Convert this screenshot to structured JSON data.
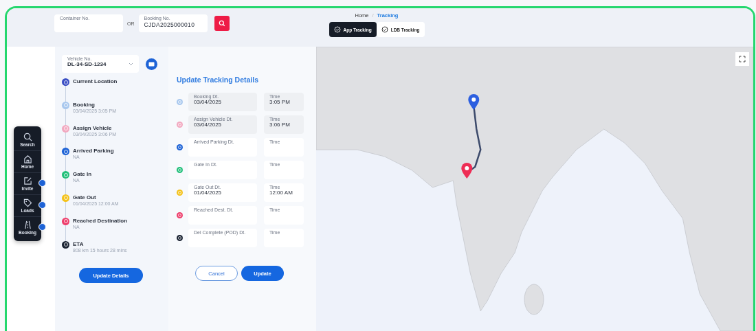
{
  "search": {
    "fields": [
      {
        "label": "Container No."
      },
      {
        "label": "Booking No.",
        "value": "CJDA2025000010"
      }
    ],
    "separator": "OR"
  },
  "breadcrumb": [
    {
      "label": "Home",
      "selected": false
    },
    {
      "label": "Tracking",
      "selected": true
    }
  ],
  "breadcrumb_separator": "/",
  "tabs": [
    {
      "label": "App Tracking",
      "selected": true
    },
    {
      "label": "LDB Tracking",
      "selected": false
    }
  ],
  "nav": [
    {
      "label": "Search",
      "badge": false
    },
    {
      "label": "Home",
      "badge": false
    },
    {
      "label": "Invite",
      "badge": true
    },
    {
      "label": "Loads",
      "badge": true
    },
    {
      "label": "Booking",
      "badge": true
    }
  ],
  "vehicle": {
    "label": "Vehicle No.",
    "value": "DL-34-SD-1234"
  },
  "timeline": [
    {
      "title": "Current Location",
      "color": "#3b4fc4"
    },
    {
      "title": "Booking",
      "detail": "03/04/2025 3:05 PM",
      "color": "#a9c8ee"
    },
    {
      "title": "Assign Vehicle",
      "detail": "03/04/2025 3:06 PM",
      "color": "#f2a9c0"
    },
    {
      "title": "Arrived Parking",
      "detail": "NA",
      "color": "#1e63d6"
    },
    {
      "title": "Gate In",
      "detail": "NA",
      "color": "#22c07a"
    },
    {
      "title": "Gate Out",
      "detail": "01/04/2025 12:00 AM",
      "color": "#f4c21a"
    },
    {
      "title": "Reached Destination",
      "detail": "NA",
      "color": "#ee3f6c"
    },
    {
      "title": "ETA",
      "detail": "808 km 15 hours 28 mins",
      "color": "#1b2433"
    }
  ],
  "update_details": "Update Details",
  "form": {
    "title": "Update Tracking Details",
    "rows": [
      {
        "color": "#a9c8ee",
        "date_label": "Booking Dt.",
        "date_value": "03/04/2025",
        "time_label": "Time",
        "time_value": "3:05 PM",
        "disabled": true
      },
      {
        "color": "#f2a9c0",
        "date_label": "Assign Vehicle Dt.",
        "date_value": "03/04/2025",
        "time_label": "Time",
        "time_value": "3:06 PM",
        "disabled": true
      },
      {
        "color": "#1e63d6",
        "date_label": "Arrived Parking Dt.",
        "time_label": "Time",
        "disabled": false
      },
      {
        "color": "#22c07a",
        "date_label": "Gate In Dt.",
        "time_label": "Time",
        "disabled": false
      },
      {
        "color": "#f4c21a",
        "date_label": "Gate Out Dt.",
        "date_value": "01/04/2025",
        "time_label": "Time",
        "time_value": "12:00 AM",
        "disabled": false
      },
      {
        "color": "#ee3f6c",
        "date_label": "Reached Dest. Dt.",
        "time_label": "Time",
        "disabled": false
      },
      {
        "color": "#1b2433",
        "date_label": "Del Complete (POD) Dt.",
        "time_label": "Time",
        "disabled": false
      }
    ],
    "buttons": [
      {
        "label": "Cancel",
        "kind": "secondary"
      },
      {
        "label": "Update",
        "kind": "primary"
      }
    ]
  }
}
